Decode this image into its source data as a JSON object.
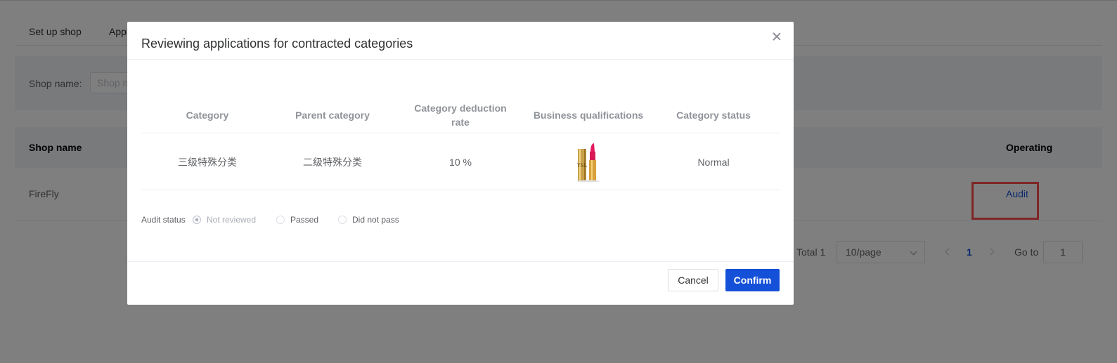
{
  "tabs": [
    "Set up shop",
    "Appl"
  ],
  "filter": {
    "label": "Shop name:",
    "placeholder": "Shop n"
  },
  "table": {
    "headers": {
      "shop_name": "Shop name",
      "operating": "Operating"
    },
    "rows": [
      {
        "shop_name": "FireFly",
        "action": "Audit"
      }
    ]
  },
  "pagination": {
    "total": "Total 1",
    "page_size": "10/page",
    "current_page": "1",
    "goto_label": "Go to",
    "goto_value": "1"
  },
  "modal": {
    "title": "Reviewing applications for contracted categories",
    "columns": [
      "Category",
      "Parent category",
      "Category deduction rate",
      "Business qualifications",
      "Category status"
    ],
    "row": {
      "category": "三级特殊分类",
      "parent_category": "二级特殊分类",
      "deduction_rate": "10 %",
      "qualification_image": "lipstick-image",
      "status": "Normal"
    },
    "audit_status": {
      "label": "Audit status",
      "options": [
        "Not reviewed",
        "Passed",
        "Did not pass"
      ],
      "selected": "Not reviewed"
    },
    "cancel_label": "Cancel",
    "confirm_label": "Confirm"
  },
  "colors": {
    "primary": "#1550d8",
    "highlight": "#ff4d4d",
    "overlay": "rgba(0,0,0,0.5)"
  }
}
